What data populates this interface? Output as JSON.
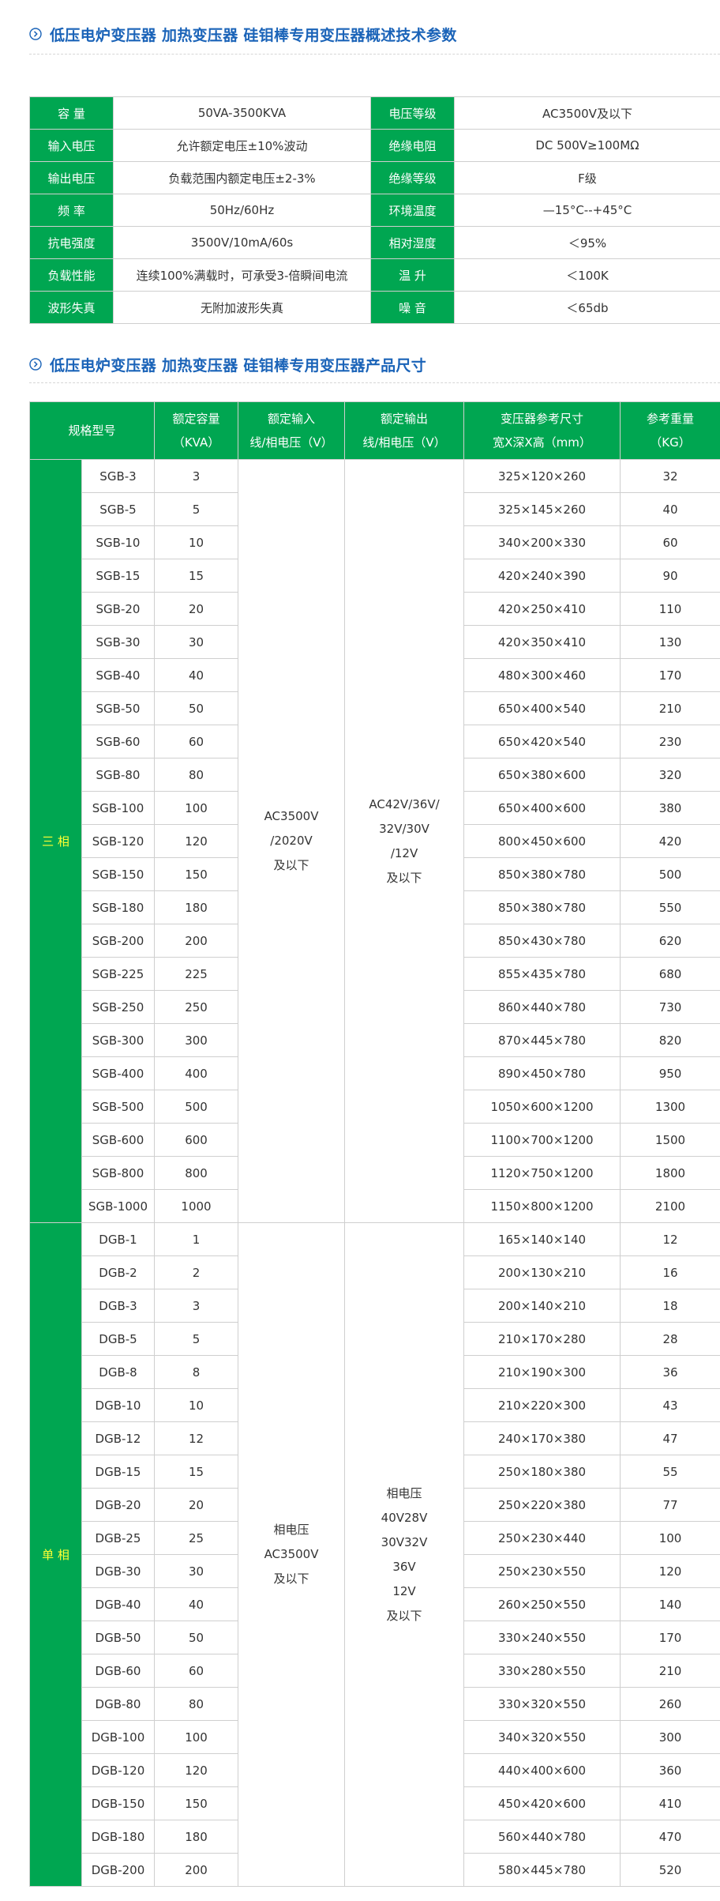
{
  "section1": {
    "title": "低压电炉变压器 加热变压器 硅钼棒专用变压器概述技术参数"
  },
  "section2": {
    "title": "低压电炉变压器 加热变压器 硅钼棒专用变压器产品尺寸"
  },
  "params": [
    [
      "容  量",
      "50VA-3500KVA",
      "电压等级",
      "AC3500V及以下"
    ],
    [
      "输入电压",
      "允许额定电压±10%波动",
      "绝缘电阻",
      "DC 500V≥100MΩ"
    ],
    [
      "输出电压",
      "负载范围内额定电压±2-3%",
      "绝缘等级",
      "F级"
    ],
    [
      "频  率",
      "50Hz/60Hz",
      "环境温度",
      "—15°C--+45°C"
    ],
    [
      "抗电强度",
      "3500V/10mA/60s",
      "相对湿度",
      "＜95%"
    ],
    [
      "负载性能",
      "连续100%满载时，可承受3-倍瞬间电流",
      "温  升",
      "＜100K"
    ],
    [
      "波形失真",
      "无附加波形失真",
      "噪  音",
      "＜65db"
    ]
  ],
  "size_table": {
    "headers": [
      [
        "规格型号"
      ],
      [
        "额定容量",
        "（KVA）"
      ],
      [
        "额定输入",
        "线/相电压（V）"
      ],
      [
        "额定输出",
        "线/相电压（V）"
      ],
      [
        "变压器参考尺寸",
        "宽X深X高（mm）"
      ],
      [
        "参考重量",
        "（KG）"
      ]
    ],
    "groups": [
      {
        "phase": "三 相",
        "input": [
          "AC3500V",
          "/2020V",
          "及以下"
        ],
        "output": [
          "AC42V/36V/",
          "32V/30V",
          "/12V",
          "及以下"
        ],
        "rows": [
          [
            "SGB-3",
            "3",
            "325×120×260",
            "32"
          ],
          [
            "SGB-5",
            "5",
            "325×145×260",
            "40"
          ],
          [
            "SGB-10",
            "10",
            "340×200×330",
            "60"
          ],
          [
            "SGB-15",
            "15",
            "420×240×390",
            "90"
          ],
          [
            "SGB-20",
            "20",
            "420×250×410",
            "110"
          ],
          [
            "SGB-30",
            "30",
            "420×350×410",
            "130"
          ],
          [
            "SGB-40",
            "40",
            "480×300×460",
            "170"
          ],
          [
            "SGB-50",
            "50",
            "650×400×540",
            "210"
          ],
          [
            "SGB-60",
            "60",
            "650×420×540",
            "230"
          ],
          [
            "SGB-80",
            "80",
            "650×380×600",
            "320"
          ],
          [
            "SGB-100",
            "100",
            "650×400×600",
            "380"
          ],
          [
            "SGB-120",
            "120",
            "800×450×600",
            "420"
          ],
          [
            "SGB-150",
            "150",
            "850×380×780",
            "500"
          ],
          [
            "SGB-180",
            "180",
            "850×380×780",
            "550"
          ],
          [
            "SGB-200",
            "200",
            "850×430×780",
            "620"
          ],
          [
            "SGB-225",
            "225",
            "855×435×780",
            "680"
          ],
          [
            "SGB-250",
            "250",
            "860×440×780",
            "730"
          ],
          [
            "SGB-300",
            "300",
            "870×445×780",
            "820"
          ],
          [
            "SGB-400",
            "400",
            "890×450×780",
            "950"
          ],
          [
            "SGB-500",
            "500",
            "1050×600×1200",
            "1300"
          ],
          [
            "SGB-600",
            "600",
            "1100×700×1200",
            "1500"
          ],
          [
            "SGB-800",
            "800",
            "1120×750×1200",
            "1800"
          ],
          [
            "SGB-1000",
            "1000",
            "1150×800×1200",
            "2100"
          ]
        ]
      },
      {
        "phase": "单 相",
        "input": [
          "相电压",
          "AC3500V",
          "及以下"
        ],
        "output": [
          "相电压",
          "40V28V",
          "30V32V",
          "36V",
          "12V",
          "及以下"
        ],
        "rows": [
          [
            "DGB-1",
            "1",
            "165×140×140",
            "12"
          ],
          [
            "DGB-2",
            "2",
            "200×130×210",
            "16"
          ],
          [
            "DGB-3",
            "3",
            "200×140×210",
            "18"
          ],
          [
            "DGB-5",
            "5",
            "210×170×280",
            "28"
          ],
          [
            "DGB-8",
            "8",
            "210×190×300",
            "36"
          ],
          [
            "DGB-10",
            "10",
            "210×220×300",
            "43"
          ],
          [
            "DGB-12",
            "12",
            "240×170×380",
            "47"
          ],
          [
            "DGB-15",
            "15",
            "250×180×380",
            "55"
          ],
          [
            "DGB-20",
            "20",
            "250×220×380",
            "77"
          ],
          [
            "DGB-25",
            "25",
            "250×230×440",
            "100"
          ],
          [
            "DGB-30",
            "30",
            "250×230×550",
            "120"
          ],
          [
            "DGB-40",
            "40",
            "260×250×550",
            "140"
          ],
          [
            "DGB-50",
            "50",
            "330×240×550",
            "170"
          ],
          [
            "DGB-60",
            "60",
            "330×280×550",
            "210"
          ],
          [
            "DGB-80",
            "80",
            "330×320×550",
            "260"
          ],
          [
            "DGB-100",
            "100",
            "340×320×550",
            "300"
          ],
          [
            "DGB-120",
            "120",
            "440×400×600",
            "360"
          ],
          [
            "DGB-150",
            "150",
            "450×420×600",
            "410"
          ],
          [
            "DGB-180",
            "180",
            "560×440×780",
            "470"
          ],
          [
            "DGB-200",
            "200",
            "580×445×780",
            "520"
          ]
        ]
      }
    ]
  },
  "colors": {
    "accent_green": "#00a651",
    "title_blue": "#1a63b8",
    "phase_text": "#ffff33"
  },
  "icons": {
    "section_marker": "circle-chevron-right-icon"
  }
}
